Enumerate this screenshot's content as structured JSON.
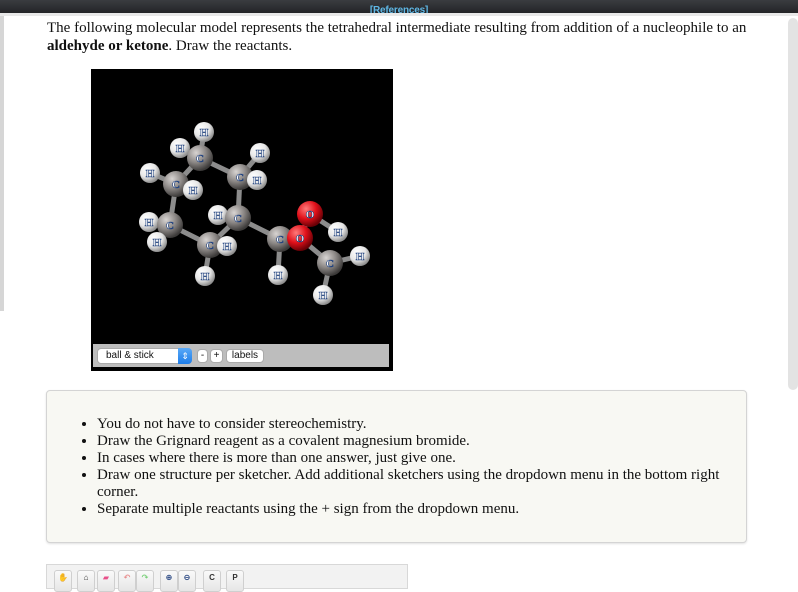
{
  "header": {
    "references_label": "[References]"
  },
  "question": {
    "text_part1": "The following molecular model represents the tetrahedral intermediate resulting from addition of a nucleophile to an ",
    "text_bold": "aldehyde or ketone",
    "text_part2": ". Draw the reactants."
  },
  "viewer": {
    "display_mode": "ball & stick",
    "zoom_out_label": "-",
    "zoom_in_label": "+",
    "labels_label": "labels",
    "colors": {
      "background": "#000000",
      "carbon": "#8a8684",
      "hydrogen": "#f2f2f2",
      "oxygen": "#e0101a",
      "bond": "#8c8c8c"
    },
    "atoms": [
      {
        "el": "H",
        "label": "H"
      },
      {
        "el": "H",
        "label": "H"
      },
      {
        "el": "C",
        "label": "C"
      },
      {
        "el": "H",
        "label": "H"
      },
      {
        "el": "C",
        "label": "C"
      },
      {
        "el": "H",
        "label": "H"
      },
      {
        "el": "H",
        "label": "H"
      },
      {
        "el": "C",
        "label": "C"
      },
      {
        "el": "H",
        "label": "H"
      },
      {
        "el": "H",
        "label": "H"
      },
      {
        "el": "C",
        "label": "C"
      },
      {
        "el": "O",
        "label": "O"
      },
      {
        "el": "H",
        "label": "H"
      },
      {
        "el": "H",
        "label": "H"
      },
      {
        "el": "C",
        "label": "C"
      },
      {
        "el": "H",
        "label": "H"
      },
      {
        "el": "C",
        "label": "C"
      },
      {
        "el": "H",
        "label": "H"
      },
      {
        "el": "C",
        "label": "C"
      },
      {
        "el": "O",
        "label": "O"
      },
      {
        "el": "C",
        "label": "C"
      },
      {
        "el": "H",
        "label": "H"
      },
      {
        "el": "H",
        "label": "H"
      },
      {
        "el": "H",
        "label": "H"
      },
      {
        "el": "H",
        "label": "H"
      }
    ]
  },
  "instructions": [
    "You do not have to consider stereochemistry.",
    "Draw the Grignard reagent as a covalent magnesium bromide.",
    "In cases where there is more than one answer, just give one.",
    "Draw one structure per sketcher. Add additional sketchers using the dropdown menu in the bottom right corner.",
    "Separate multiple reactants using the + sign from the dropdown menu."
  ],
  "sketcher_toolbar": {
    "tools": [
      {
        "name": "move-tool",
        "glyph": "✋"
      },
      {
        "name": "lasso-tool",
        "glyph": "⌂"
      },
      {
        "name": "eraser-tool",
        "glyph": "▰"
      },
      {
        "name": "undo-tool",
        "glyph": "↶"
      },
      {
        "name": "redo-tool",
        "glyph": "↷"
      },
      {
        "name": "zoom-in-tool",
        "glyph": "⊕"
      },
      {
        "name": "zoom-out-tool",
        "glyph": "⊖"
      },
      {
        "name": "clean-tool",
        "glyph": "C"
      },
      {
        "name": "periodic-tool",
        "glyph": "P"
      }
    ]
  }
}
